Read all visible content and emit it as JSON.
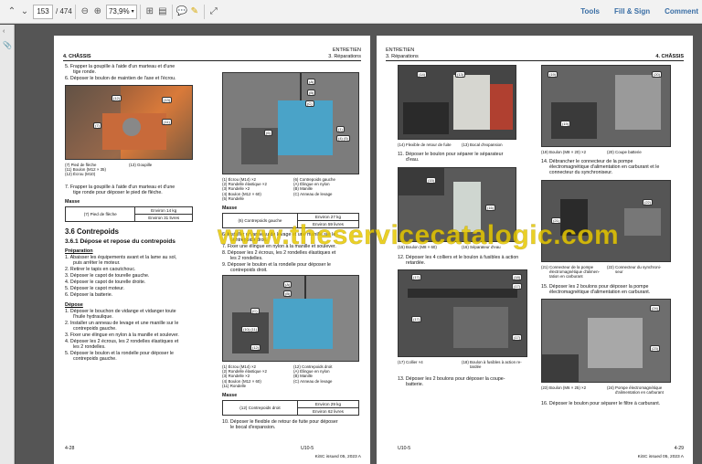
{
  "toolbar": {
    "page_current": "153",
    "page_total": "/ 474",
    "zoom": "73,9%",
    "tools": "Tools",
    "fill_sign": "Fill & Sign",
    "comment": "Comment"
  },
  "left": {
    "hdr_left": "4. CHÂSSIS",
    "hdr_r1": "ENTRETIEN",
    "hdr_r2": "3. Réparations",
    "s5": "5.   Frapper la goupille à l'aide d'un marteau et d'une",
    "s5b": "tige ronde.",
    "s6": "6.   Déposer le boulon de maintien de l'axe et l'écrou.",
    "ph1_cap": [
      "(7)   Pied de flèche",
      "(11) Boulon (M12 × 35)",
      "(12) Écrou (M10)",
      "(13) Goupille"
    ],
    "s7": "7.   Frapper la goupille à l'aide d'un marteau et d'une",
    "s7b": "tige ronde pour déposer le pied de flèche.",
    "masse": "Masse",
    "t1_a": "(7) Pied de flèche",
    "t1_b": "Environ 14 kg",
    "t1_c": "Environ 31 livres",
    "h36": "3.6 Contrepoids",
    "h361": "3.6.1 Dépose et repose du contrepoids",
    "prep": "Préparation",
    "p1": "1.   Abaisser les équipements avant et la lame au sol,",
    "p1b": "puis arrêter le moteur.",
    "p2": "2.   Retirer le tapis en caoutchouc.",
    "p3": "3.   Déposer le capot de tourelle gauche.",
    "p4": "4.   Déposer le capot de tourelle droite.",
    "p5": "5.   Déposer le capot moteur.",
    "p6": "6.   Déposer la batterie.",
    "dep": "Dépose",
    "d1": "1.   Déposer le bouchon de vidange et vidanger toute",
    "d1b": "l'huile hydraulique.",
    "d2": "2.   Installer un anneau de levage et une manille sur le",
    "d2b": "contrepoids gauche.",
    "d3": "3.   Fixer une élingue en nylon à la manille et soulever.",
    "d4": "4.   Déposer les 2 écrous, les 2 rondelles élastiques et",
    "d4b": "les 2 rondelles.",
    "d5": "5.   Déposer le boulon et la rondelle pour déposer le",
    "d5b": "contrepoids gauche.",
    "ph2_capL": [
      "(1)   Écrou (M14) ×2",
      "(2)   Rondelle élastique ×2",
      "(3)   Rondelle ×2",
      "(4)   Boulon (M12 × 60)",
      "(5)   Rondelle"
    ],
    "ph2_capR": [
      "(6)   Contrepoids gauche",
      "(A)   Élingue en nylon",
      "(B)   Manille",
      "(C)   Anneau de levage"
    ],
    "t2_a": "(6) Contrepoids gauche",
    "t2_b": "Environ 27 kg",
    "t2_c": "Environ 59 livres",
    "s6b": "6.   Installer un anneau de levage et une manille sur le",
    "s6c": "contrepoids droit.",
    "s7c": "7.   Fixer une élingue en nylon à la manille et soulever.",
    "s8": "8.   Déposer les 2 écrous, les 2 rondelles élastiques et",
    "s8b": "les 2 rondelles.",
    "s9": "9.   Déposer le boulon et la rondelle pour déposer le",
    "s9b": "contrepoids droit.",
    "ph3_capL": [
      "(1)   Écrou (M14) ×2",
      "(2)   Rondelle élastique ×2",
      "(3)   Rondelle ×2",
      "(4)   Boulon (M12 × 60)",
      "(11) Rondelle"
    ],
    "ph3_capR": [
      "(12) Contrepoids droit",
      "(A)   Élingue en nylon",
      "(B)   Manille",
      "(C)   Anneau de levage"
    ],
    "t3_a": "(12) Contrepoids droit",
    "t3_b": "Environ 29 kg",
    "t3_c": "Environ 62 livres",
    "s10": "10. Déposer le flexible de retour de fuite pour déposer",
    "s10b": "le bocal d'expansion.",
    "f_left": "4-28",
    "f_mid": "U10-5",
    "f_right": "KiSC issued 05, 2023 A"
  },
  "right": {
    "hdr_l1": "ENTRETIEN",
    "hdr_l2": "3. Réparations",
    "hdr_right": "4. CHÂSSIS",
    "c1": [
      "(14) Flexible de retour de fuite",
      "(13) Bocal d'expansion"
    ],
    "s11": "11. Déposer le boulon pour séparer le séparateur",
    "s11b": "d'eau.",
    "c2": [
      "(15) Boulon (M8 × 60)",
      "(16) Séparateur d'eau"
    ],
    "s12": "12. Déposer les 4 colliers et le boulon à fusibles à action",
    "s12b": "retardée.",
    "c3": [
      "(17) Collier ×4",
      "(18) Boulon à fusibles à action re-",
      "tardée"
    ],
    "s13": "13. Déposer les 2 boulons pour déposer la coupe-",
    "s13b": "batterie.",
    "c4": [
      "(19) Boulon (M8 × 20) ×2",
      "(20) Coupe batterie"
    ],
    "s14": "14. Débrancher le connecteur de la pompe",
    "s14b": "électromagnétique d'alimentation en carburant et le",
    "s14c": "connecteur du synchroniseur.",
    "c5": [
      "(21) Connecteur de la pompe",
      "électromagnétique d'alimen-",
      "tation en carburant",
      "(22) Connecteur du synchroni-",
      "seur"
    ],
    "s15": "15. Déposer les 2 boulons pour déposer la pompe",
    "s15b": "électromagnétique d'alimentation en carburant.",
    "c6": [
      "(23) Boulon (M6 × 25) ×2",
      "(24) Pompe électromagnétique",
      "d'alimentation en carburant"
    ],
    "s16": "16. Déposer le boulon pour séparer le filtre à carburant.",
    "f_left": "U10-5",
    "f_right_num": "4-29",
    "f_right": "KiSC issued 05, 2023 A"
  },
  "watermark": "www.theservicecatalogic.com",
  "colors": {
    "accent": "#3a6ea5",
    "watermark": "#e6c800",
    "counterweight_blue": "#4aa3c8"
  }
}
